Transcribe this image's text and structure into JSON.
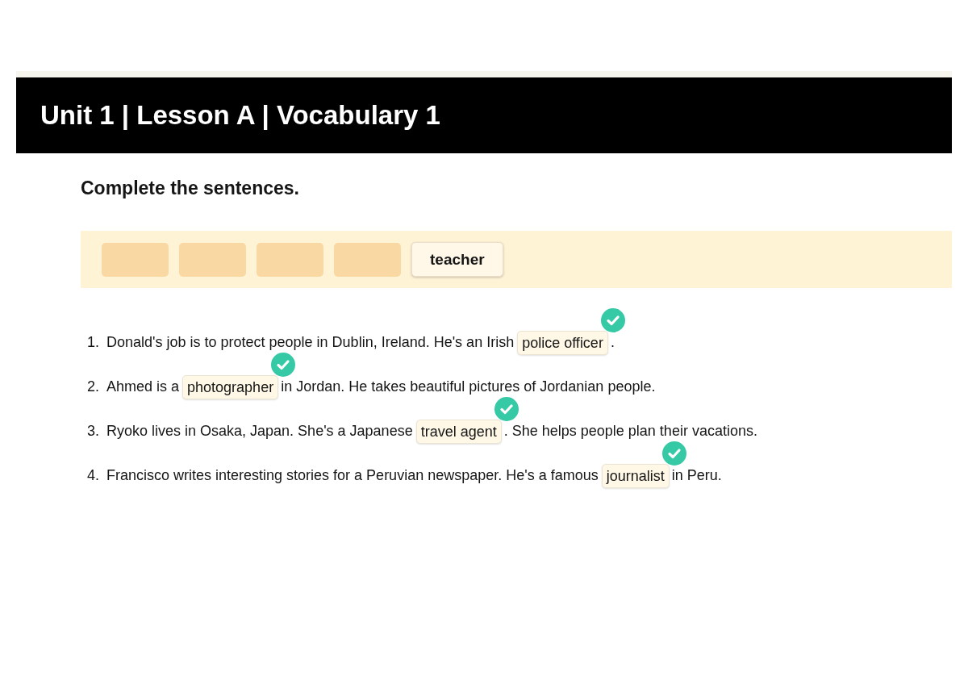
{
  "header": {
    "title": "Unit 1 | Lesson A | Vocabulary 1"
  },
  "instruction": "Complete the sentences.",
  "word_bank": {
    "items": [
      {
        "kind": "empty"
      },
      {
        "kind": "empty"
      },
      {
        "kind": "empty"
      },
      {
        "kind": "empty"
      },
      {
        "kind": "word",
        "text": "teacher"
      }
    ]
  },
  "sentences": [
    {
      "number": "1.",
      "parts": [
        {
          "kind": "text",
          "text": "Donald's job is to protect people in Dublin, Ireland. He's an Irish"
        },
        {
          "kind": "answer",
          "text": "police officer",
          "correct": true
        },
        {
          "kind": "text",
          "text": "."
        }
      ]
    },
    {
      "number": "2.",
      "parts": [
        {
          "kind": "text",
          "text": "Ahmed is a"
        },
        {
          "kind": "answer",
          "text": "photographer",
          "correct": true
        },
        {
          "kind": "text",
          "text": "in Jordan. He takes beautiful pictures of Jordanian people."
        }
      ]
    },
    {
      "number": "3.",
      "parts": [
        {
          "kind": "text",
          "text": "Ryoko lives in Osaka, Japan. She's a Japanese"
        },
        {
          "kind": "answer",
          "text": "travel agent",
          "correct": true
        },
        {
          "kind": "text",
          "text": ". She helps people plan their vacations."
        }
      ]
    },
    {
      "number": "4.",
      "parts": [
        {
          "kind": "text",
          "text": "Francisco writes interesting stories for a Peruvian newspaper. He's a famous"
        },
        {
          "kind": "answer",
          "text": "journalist",
          "correct": true
        },
        {
          "kind": "text",
          "text": "in Peru."
        }
      ]
    }
  ]
}
